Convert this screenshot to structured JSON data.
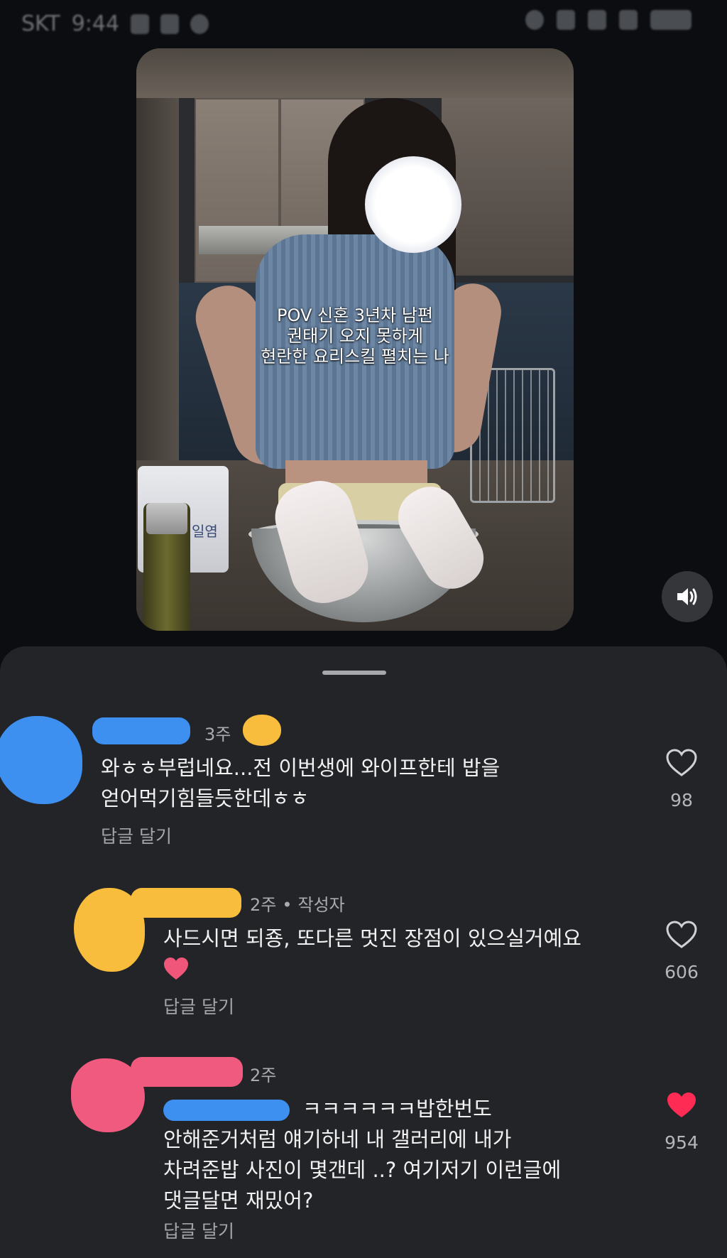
{
  "status_bar": {
    "carrier": "SKT",
    "time": "9:44"
  },
  "video": {
    "caption_lines": [
      "POV 신혼 3년차 남편",
      "권태기 오지 못하게",
      "현란한 요리스킬 펼치는 나"
    ],
    "product_label": "일염",
    "sound_icon": "speaker-icon"
  },
  "comments": [
    {
      "time": "3주",
      "author_tag": "",
      "text_lines": [
        "와ㅎㅎ부럽네요...전 이번생에 와이프한테 밥을",
        "얻어먹기힘들듯한데ㅎㅎ"
      ],
      "reply_label": "답글 달기",
      "likes": "98",
      "liked": false
    },
    {
      "time": "2주",
      "author_tag": "작성자",
      "text_lines": [
        "사드시면 되죵, 또다른 멋진 장점이 있으실거예요"
      ],
      "reply_label": "답글 달기",
      "likes": "606",
      "liked": false
    },
    {
      "time": "2주",
      "author_tag": "",
      "text_lines": [
        "ㅋㅋㅋㅋㅋㅋ밥한번도",
        "안해준거처럼 얘기하네 내 갤러리에 내가",
        "차려준밥 사진이 몇갠데 ..? 여기저기 이런글에",
        "댓글달면 재밌어?"
      ],
      "reply_label": "답글 달기",
      "likes": "954",
      "liked": true
    }
  ],
  "colors": {
    "liked_red": "#fe2c55",
    "sheet_bg": "#232428",
    "redaction_blue": "#3d8ff0",
    "redaction_yellow": "#f8bd3c",
    "redaction_pink": "#f05a7e"
  }
}
